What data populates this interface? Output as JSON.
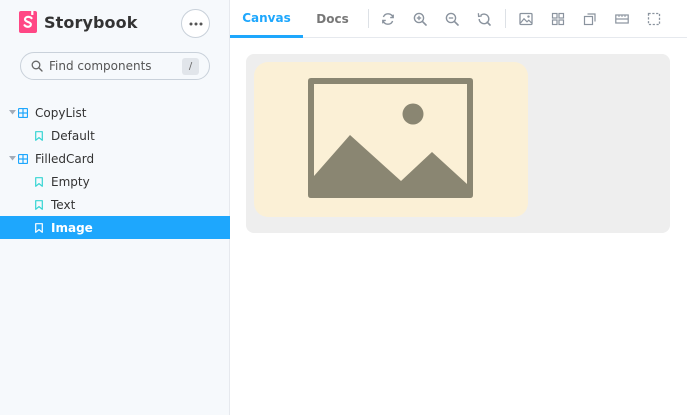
{
  "app": {
    "name": "Storybook",
    "menu_icon": "ellipsis-icon",
    "brand_color": "#ff4785",
    "accent_color": "#1ea7fd"
  },
  "search": {
    "placeholder": "Find components",
    "shortcut": "/"
  },
  "tree": {
    "components": [
      {
        "label": "CopyList",
        "stories": [
          {
            "label": "Default",
            "selected": false
          }
        ]
      },
      {
        "label": "FilledCard",
        "stories": [
          {
            "label": "Empty",
            "selected": false
          },
          {
            "label": "Text",
            "selected": false
          },
          {
            "label": "Image",
            "selected": true
          }
        ]
      }
    ]
  },
  "toolbar": {
    "tabs": [
      {
        "label": "Canvas",
        "active": true
      },
      {
        "label": "Docs",
        "active": false
      }
    ],
    "tools": [
      "refresh-icon",
      "zoom-in-icon",
      "zoom-out-icon",
      "zoom-reset-icon",
      "background-icon",
      "grid-icon",
      "viewport-icon",
      "measure-icon",
      "outline-icon"
    ]
  },
  "canvas": {
    "frame_color": "#eeeeee",
    "card_color": "#fbf0d6",
    "placeholder_icon": "image-placeholder-icon",
    "icon_color": "#8a8672"
  }
}
